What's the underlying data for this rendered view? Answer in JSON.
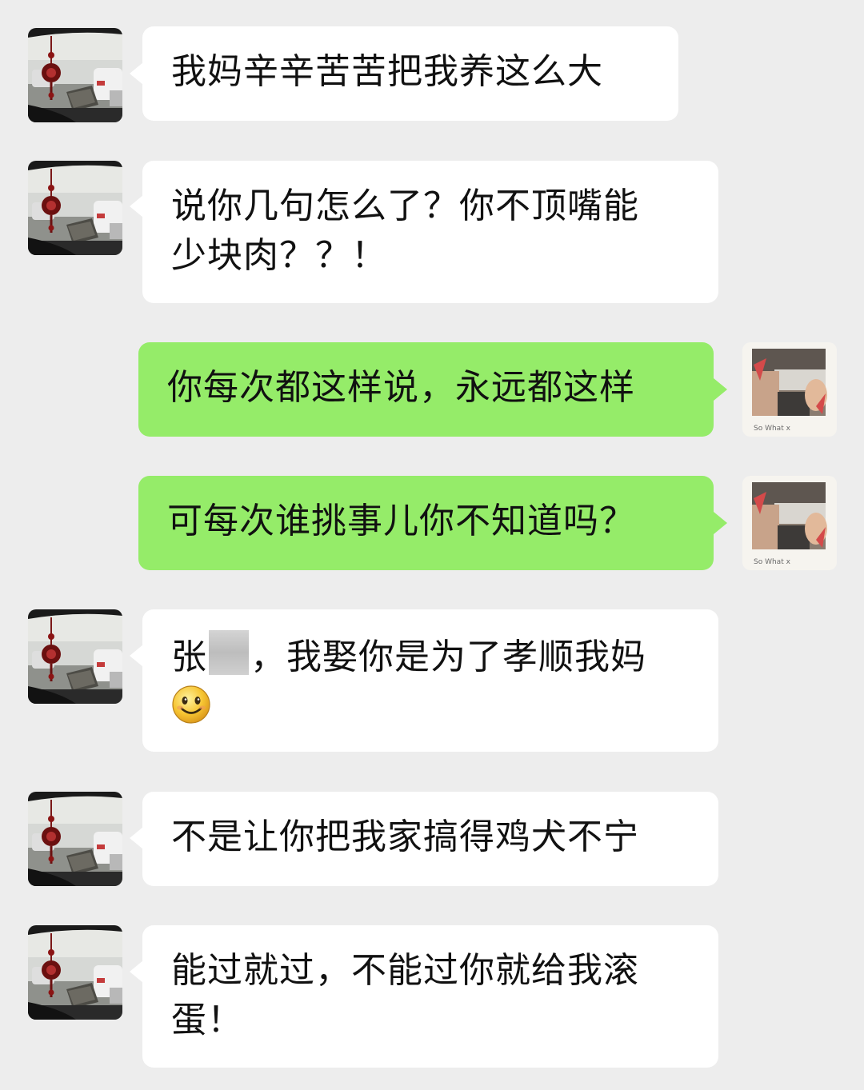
{
  "messages": [
    {
      "side": "left",
      "text": "我妈辛辛苦苦把我养这么大"
    },
    {
      "side": "left",
      "line1": "说你几句怎么了？你不顶嘴能",
      "line2": "少块肉？？！"
    },
    {
      "side": "right",
      "text": "你每次都这样说，永远都这样"
    },
    {
      "side": "right",
      "text": "可每次谁挑事儿你不知道吗？"
    },
    {
      "side": "left",
      "prefix": "张",
      "suffix": "，我娶你是为了孝顺我妈",
      "emoji": "smiling-face-icon"
    },
    {
      "side": "left",
      "text": "不是让你把我家搞得鸡犬不宁"
    },
    {
      "side": "left",
      "line1": "能过就过，不能过你就给我滚",
      "line2": "蛋！"
    }
  ],
  "avatar_caption": "So What x",
  "colors": {
    "background": "#ededed",
    "incoming_bubble": "#ffffff",
    "outgoing_bubble": "#95ec69"
  }
}
